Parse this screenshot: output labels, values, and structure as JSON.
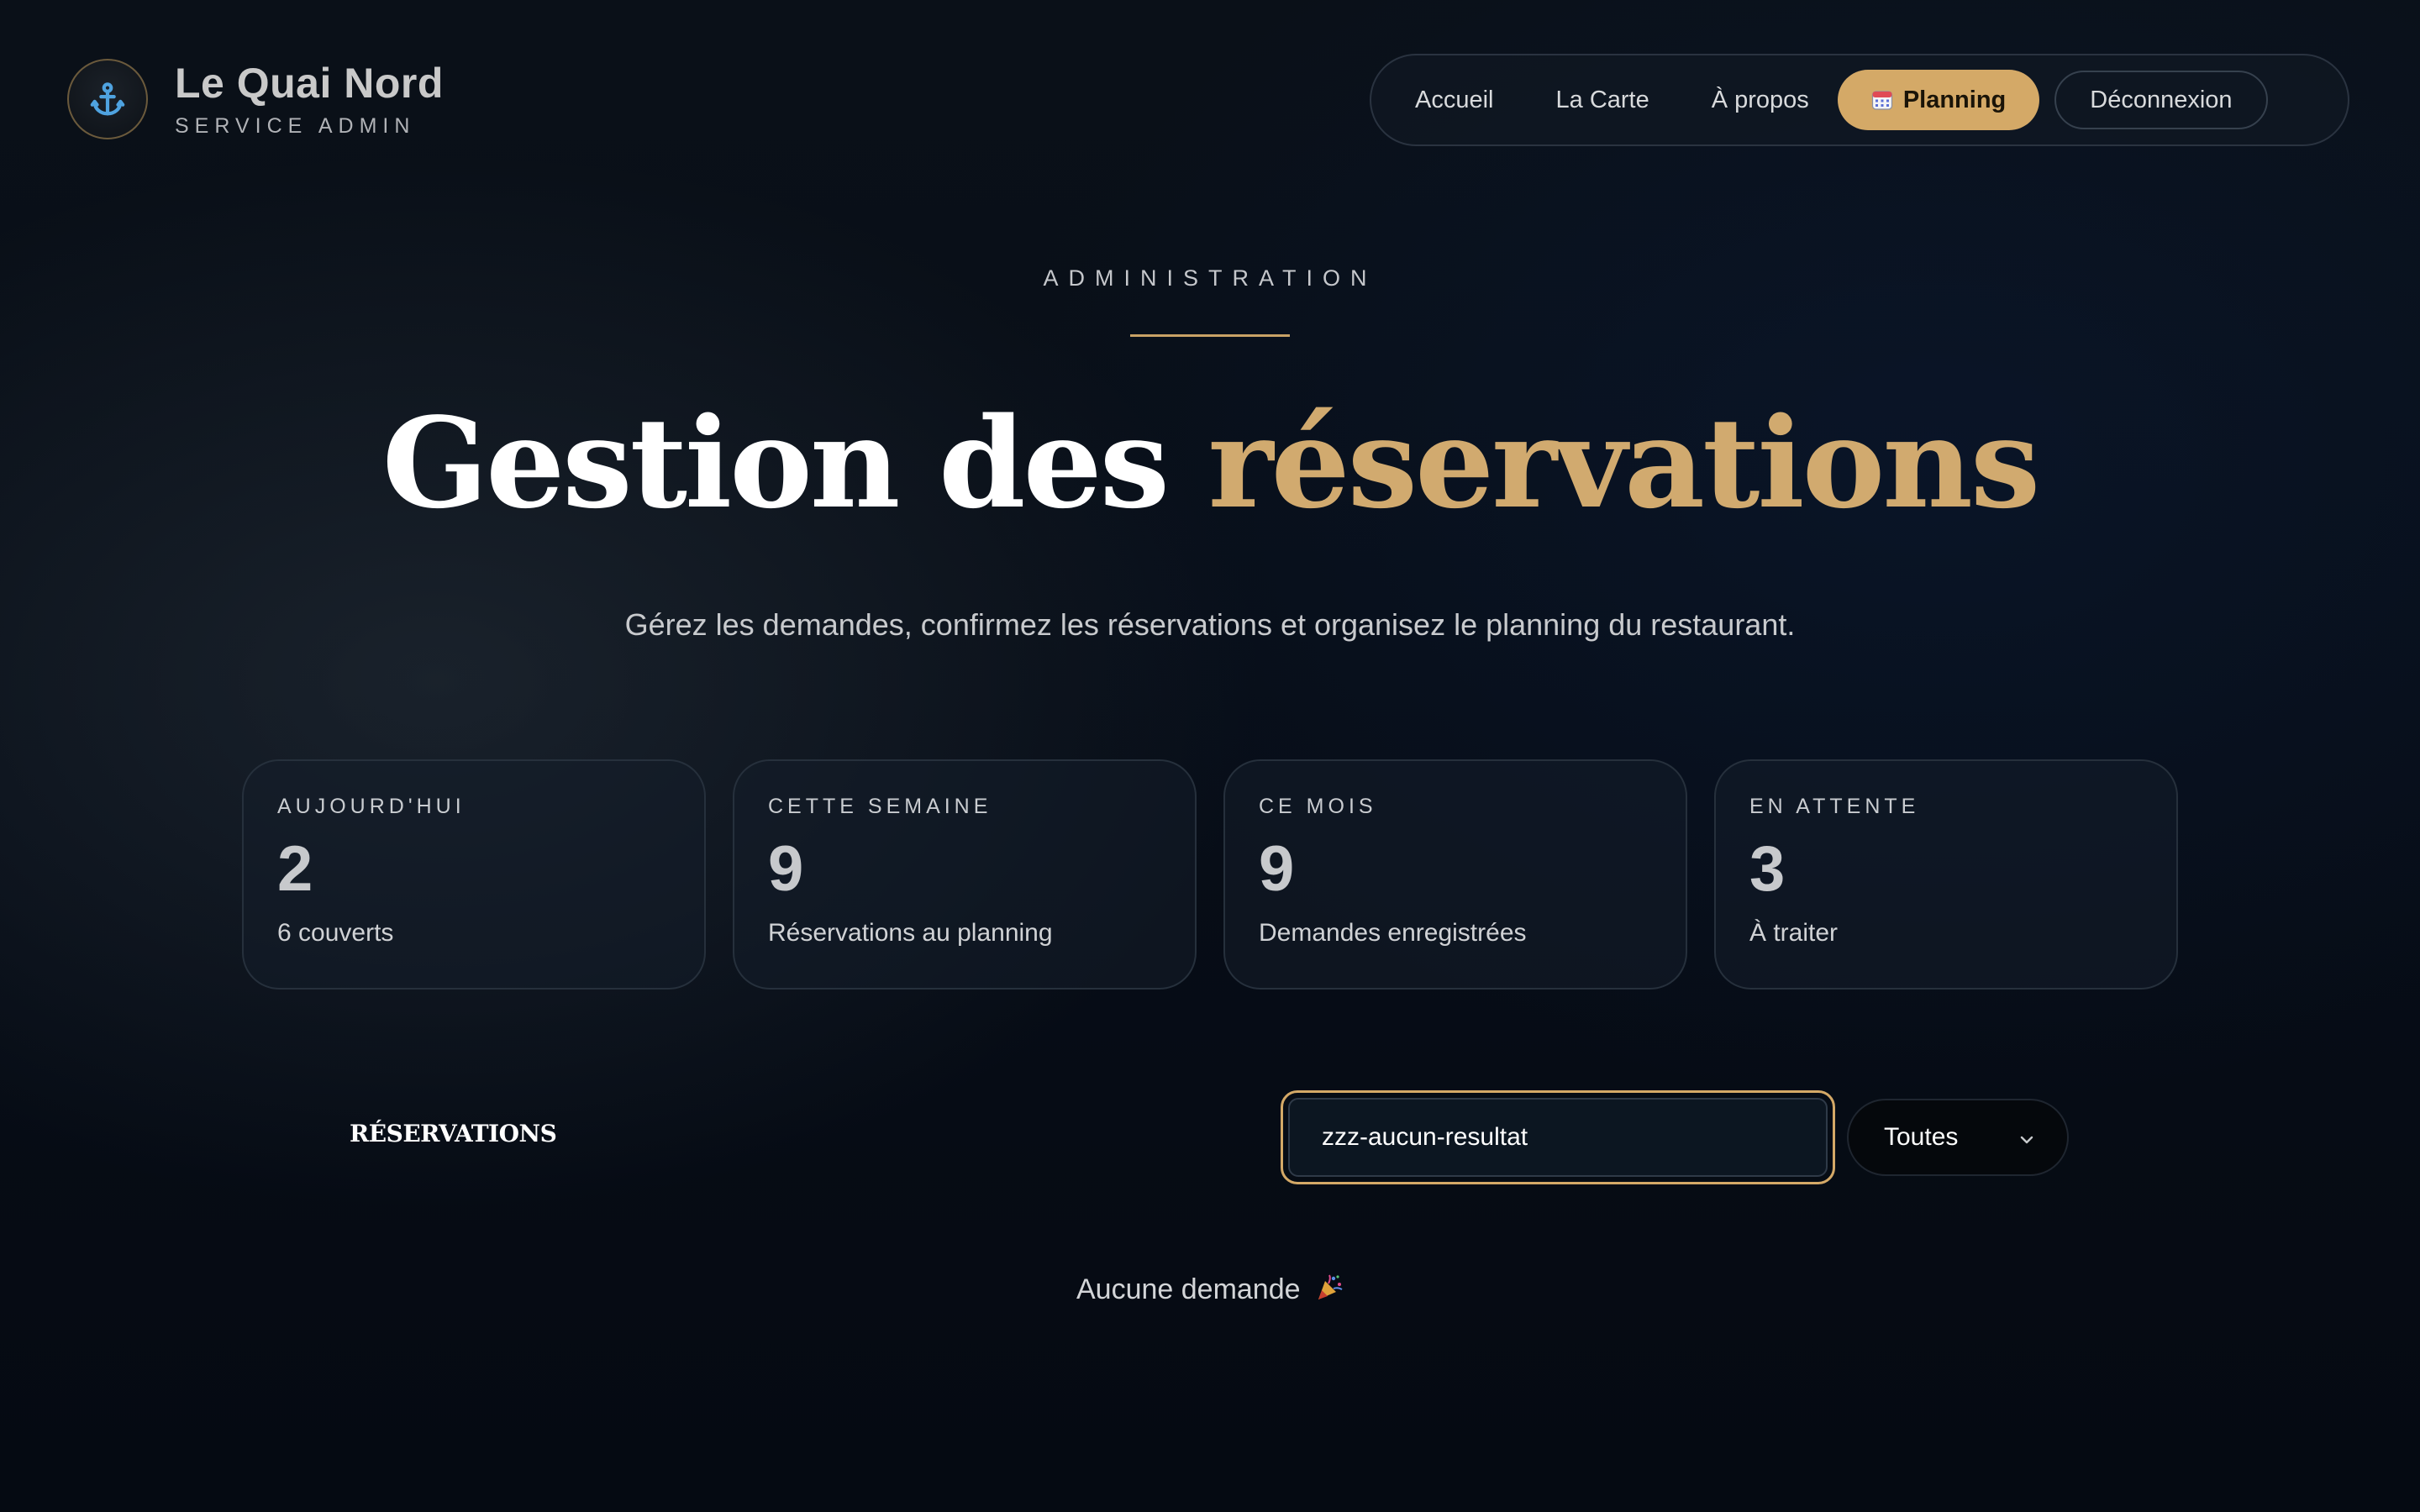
{
  "brand": {
    "name": "Le Quai Nord",
    "subtitle": "SERVICE ADMIN",
    "logo_icon": "anchor-icon"
  },
  "nav": {
    "items": [
      {
        "label": "Accueil"
      },
      {
        "label": "La Carte"
      },
      {
        "label": "À propos"
      },
      {
        "label": "Planning",
        "active": true,
        "icon": "calendar-icon"
      },
      {
        "label": "Déconnexion"
      }
    ]
  },
  "hero": {
    "eyebrow": "ADMINISTRATION",
    "title_main": "Gestion des ",
    "title_accent": "réservations",
    "subtitle": "Gérez les demandes, confirmez les réservations et organisez le planning du restaurant."
  },
  "stats": [
    {
      "label": "AUJOURD'HUI",
      "value": "2",
      "desc": "6 couverts"
    },
    {
      "label": "CETTE SEMAINE",
      "value": "9",
      "desc": "Réservations au planning"
    },
    {
      "label": "CE MOIS",
      "value": "9",
      "desc": "Demandes enregistrées"
    },
    {
      "label": "EN ATTENTE",
      "value": "3",
      "desc": "À traiter"
    }
  ],
  "reservations": {
    "title": "RÉSERVATIONS",
    "search_value": "zzz-aucun-resultat",
    "filter_selected": "Toutes",
    "empty_message": "Aucune demande",
    "empty_icon": "party-popper-icon"
  },
  "colors": {
    "accent": "#d4a967",
    "background": "#070d17",
    "card_border": "#26303c"
  }
}
